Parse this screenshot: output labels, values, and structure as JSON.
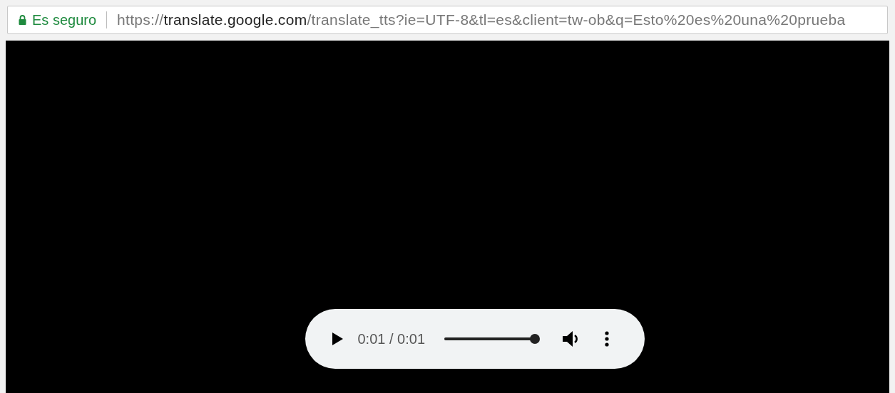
{
  "address_bar": {
    "security_label": "Es seguro",
    "url": {
      "scheme": "https://",
      "host": "translate.google.com",
      "path": "/translate_tts?ie=UTF-8&tl=es&client=tw-ob&q=Esto%20es%20una%20prueba"
    }
  },
  "audio_player": {
    "time": "0:01 / 0:01",
    "level": 1
  }
}
